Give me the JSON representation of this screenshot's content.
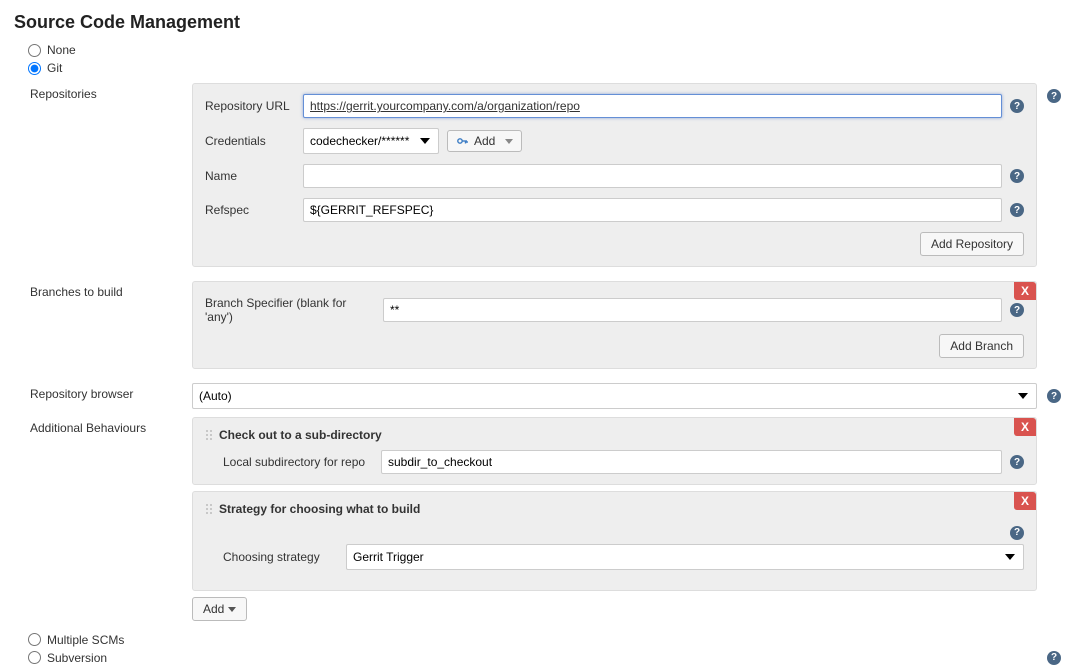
{
  "title": "Source Code Management",
  "scm_options": {
    "none": "None",
    "git": "Git",
    "multiple": "Multiple SCMs",
    "subversion": "Subversion"
  },
  "git": {
    "repositories": {
      "label": "Repositories",
      "url_label": "Repository URL",
      "url_value": "https://gerrit.yourcompany.com/a/organization/repo",
      "credentials_label": "Credentials",
      "credentials_value": "codechecker/******",
      "add_cred_btn": "Add",
      "name_label": "Name",
      "name_value": "",
      "refspec_label": "Refspec",
      "refspec_value": "${GERRIT_REFSPEC}",
      "add_repo_btn": "Add Repository"
    },
    "branches": {
      "label": "Branches to build",
      "specifier_label": "Branch Specifier (blank for 'any')",
      "specifier_value": "**",
      "add_branch_btn": "Add Branch"
    },
    "browser": {
      "label": "Repository browser",
      "value": "(Auto)"
    },
    "behaviours": {
      "label": "Additional Behaviours",
      "subdir": {
        "title": "Check out to a sub-directory",
        "local_label": "Local subdirectory for repo",
        "local_value": "subdir_to_checkout"
      },
      "strategy": {
        "title": "Strategy for choosing what to build",
        "choose_label": "Choosing strategy",
        "choose_value": "Gerrit Trigger"
      },
      "add_btn": "Add"
    }
  }
}
